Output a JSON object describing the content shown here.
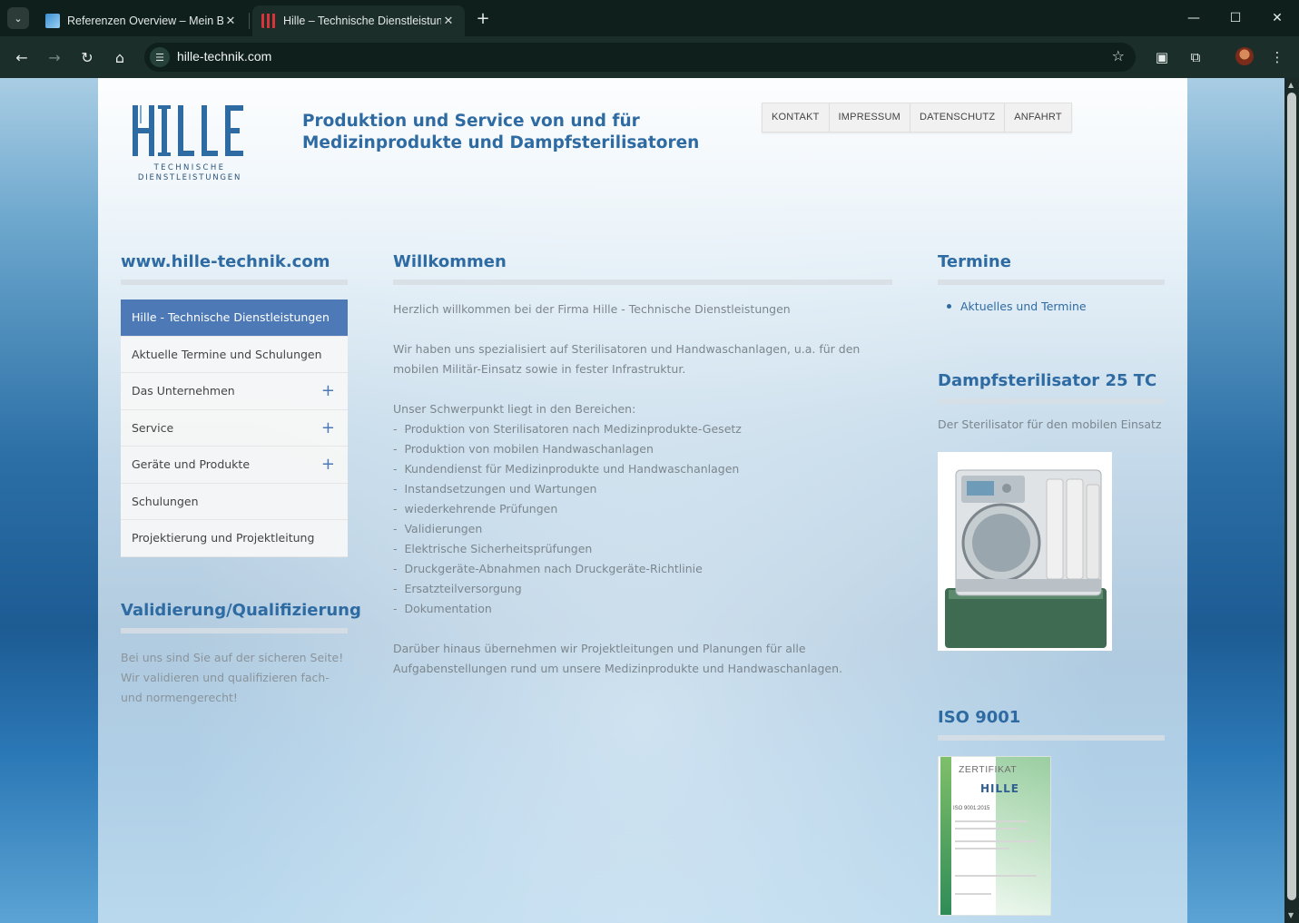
{
  "browser": {
    "tabs": [
      {
        "title": "Referenzen Overview – Mein Bl",
        "active": false
      },
      {
        "title": "Hille – Technische Dienstleistung",
        "active": true
      }
    ],
    "url": "hille-technik.com"
  },
  "header": {
    "logo_text": "HILLE",
    "logo_sub1": "TECHNISCHE",
    "logo_sub2": "DIENSTLEISTUNGEN",
    "tagline_line1": "Produktion und Service von und für",
    "tagline_line2": "Medizinprodukte und Dampfsterilisatoren",
    "nav": [
      "KONTAKT",
      "IMPRESSUM",
      "DATENSCHUTZ",
      "ANFAHRT"
    ]
  },
  "left": {
    "heading": "www.hille-technik.com",
    "menu": [
      {
        "label": "Hille - Technische Dienstleistungen",
        "expandable": false,
        "active": true
      },
      {
        "label": "Aktuelle Termine und Schulungen",
        "expandable": false,
        "active": false
      },
      {
        "label": "Das Unternehmen",
        "expandable": true,
        "active": false
      },
      {
        "label": "Service",
        "expandable": true,
        "active": false
      },
      {
        "label": "Geräte und Produkte",
        "expandable": true,
        "active": false
      },
      {
        "label": "Schulungen",
        "expandable": false,
        "active": false
      },
      {
        "label": "Projektierung und Projektleitung",
        "expandable": false,
        "active": false
      }
    ],
    "validierung_heading": "Validierung/Qualifizierung",
    "validierung_text": "Bei uns sind Sie auf der sicheren Seite! Wir validieren und qualifizieren fach- und normengerecht!"
  },
  "main": {
    "heading": "Willkommen",
    "intro": "Herzlich willkommen bei der Firma Hille - Technische Dienstleistungen",
    "para2": "Wir haben uns spezialisiert auf Sterilisatoren und Handwaschanlagen, u.a. für den mobilen Militär-Einsatz sowie in fester Infrastruktur.",
    "list_intro": "Unser Schwerpunkt liegt in den Bereichen:",
    "list": [
      "Produktion von Sterilisatoren nach Medizinprodukte-Gesetz",
      "Produktion von mobilen Handwaschanlagen",
      "Kundendienst für Medizinprodukte und Handwaschanlagen",
      "Instandsetzungen und Wartungen",
      "wiederkehrende Prüfungen",
      "Validierungen",
      "Elektrische Sicherheitsprüfungen",
      "Druckgeräte-Abnahmen nach Druckgeräte-Richtlinie",
      "Ersatzteilversorgung",
      "Dokumentation"
    ],
    "outro": "Darüber hinaus übernehmen wir Projektleitungen und Planungen für alle Aufgabenstellungen rund um unsere Medizinprodukte und Handwaschanlagen."
  },
  "right": {
    "termine_heading": "Termine",
    "termine_link": "Aktuelles und Termine",
    "steril_heading": "Dampfsterilisator 25 TC",
    "steril_text": "Der Sterilisator für den mobilen Einsatz",
    "iso_heading": "ISO 9001",
    "cert_title": "ZERTIFIKAT",
    "cert_iso": "ISO 9001:2015"
  },
  "colors": {
    "accent_blue": "#2f6ba3",
    "menu_active": "#4d7ab7",
    "text_gray": "#7c868d"
  }
}
